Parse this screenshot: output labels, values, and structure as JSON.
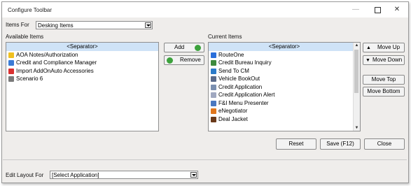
{
  "window": {
    "title": "Configure Toolbar"
  },
  "items_for": {
    "label": "Items For",
    "value": "Desking Items"
  },
  "available": {
    "label": "Available Items",
    "items": [
      {
        "label": "<Separator>",
        "icon": "",
        "selected": true
      },
      {
        "label": "AOA Notes/Authorization",
        "icon": "note-icon",
        "color": "#f0c020"
      },
      {
        "label": "Credit and Compliance Manager",
        "icon": "person-icon",
        "color": "#3a7bd5"
      },
      {
        "label": "Import AddOnAuto Accessories",
        "icon": "import-icon",
        "color": "#d93030"
      },
      {
        "label": "Scenario 6",
        "icon": "scenario-icon",
        "color": "#7a7a7a"
      }
    ]
  },
  "current": {
    "label": "Current Items",
    "items": [
      {
        "label": "<Separator>",
        "icon": "",
        "selected": true
      },
      {
        "label": "RouteOne",
        "icon": "routeone-icon",
        "color": "#2a6fdb"
      },
      {
        "label": "Credit Bureau Inquiry",
        "icon": "bureau-icon",
        "color": "#3d8a3d"
      },
      {
        "label": "Send To CM",
        "icon": "send-icon",
        "color": "#2b7bc9"
      },
      {
        "label": "Vehicle BookOut",
        "icon": "car-icon",
        "color": "#5a6a8a"
      },
      {
        "label": "Credit Application",
        "icon": "application-icon",
        "color": "#7a8fb0"
      },
      {
        "label": "Credit Application Alert",
        "icon": "alert-icon",
        "color": "#a0a8c0"
      },
      {
        "label": "F&I Menu Presenter",
        "icon": "menu-icon",
        "color": "#4a78c0"
      },
      {
        "label": "eNegotiator",
        "icon": "negotiator-icon",
        "color": "#e0761c"
      },
      {
        "label": "Deal Jacket",
        "icon": "jacket-icon",
        "color": "#6a3a1a"
      }
    ]
  },
  "buttons": {
    "add": "Add",
    "remove": "Remove",
    "move_up": "Move Up",
    "move_down": "Move Down",
    "move_top": "Move Top",
    "move_bottom": "Move Bottom",
    "reset": "Reset",
    "save": "Save (F12)",
    "close": "Close"
  },
  "edit_layout": {
    "label": "Edit Layout For",
    "value": "[Select Application]"
  }
}
